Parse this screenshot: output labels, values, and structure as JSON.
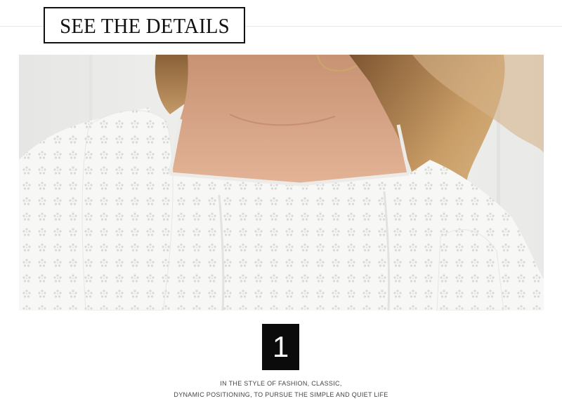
{
  "header": {
    "title": "SEE THE DETAILS"
  },
  "photo": {
    "subject": "white-eyelet-blouse-closeup",
    "colors": {
      "background": "#ececec",
      "fabric": "#f6f6f4",
      "hair": "#b88a55",
      "skin": "#d9a98a"
    }
  },
  "badge": {
    "number": "1"
  },
  "caption": {
    "line1": "IN THE STYLE OF FASHION, CLASSIC,",
    "line2": "DYNAMIC POSITIONING, TO PURSUE THE SIMPLE AND QUIET LIFE"
  }
}
